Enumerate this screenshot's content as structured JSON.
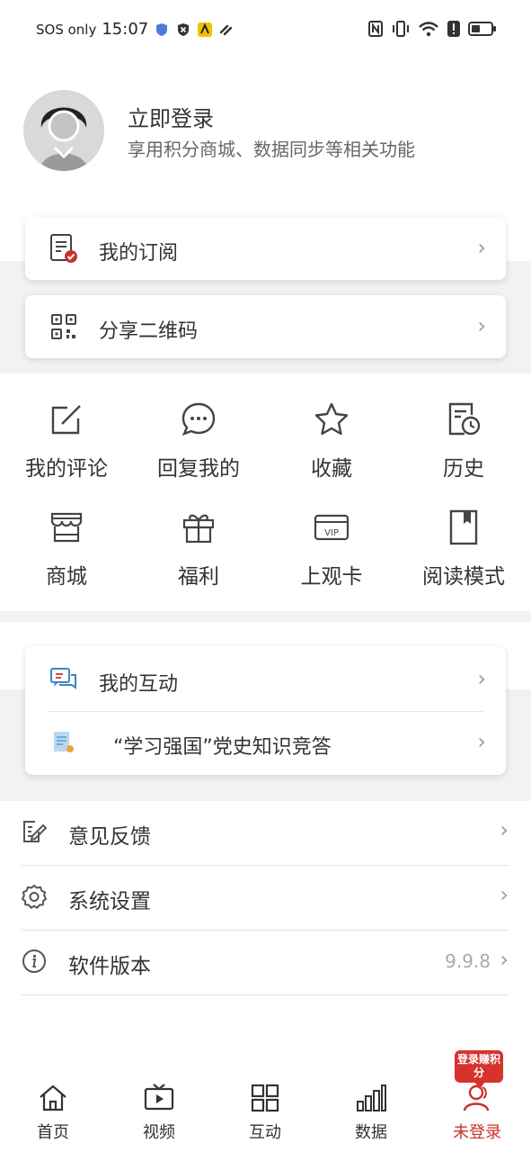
{
  "status_bar": {
    "carrier": "SOS only",
    "time": "15:07"
  },
  "profile": {
    "title": "立即登录",
    "subtitle": "享用积分商城、数据同步等相关功能"
  },
  "top_cards": [
    {
      "label": "我的订阅",
      "icon": "subscription-icon"
    },
    {
      "label": "分享二维码",
      "icon": "qr-code-icon"
    }
  ],
  "grid": [
    {
      "label": "我的评论",
      "icon": "edit-comment-icon"
    },
    {
      "label": "回复我的",
      "icon": "chat-bubble-icon"
    },
    {
      "label": "收藏",
      "icon": "star-icon"
    },
    {
      "label": "历史",
      "icon": "history-icon"
    },
    {
      "label": "商城",
      "icon": "store-icon"
    },
    {
      "label": "福利",
      "icon": "gift-icon"
    },
    {
      "label": "上观卡",
      "icon": "vip-card-icon"
    },
    {
      "label": "阅读模式",
      "icon": "bookmark-icon"
    }
  ],
  "interact_card": [
    {
      "label": "我的互动",
      "icon": "interaction-icon"
    },
    {
      "label": "“学习强国”党史知识竞答",
      "icon": "quiz-icon"
    }
  ],
  "settings": [
    {
      "label": "意见反馈",
      "icon": "feedback-icon",
      "value": ""
    },
    {
      "label": "系统设置",
      "icon": "gear-icon",
      "value": ""
    },
    {
      "label": "软件版本",
      "icon": "info-icon",
      "value": "9.9.8"
    }
  ],
  "tabbar": {
    "tabs": [
      {
        "label": "首页",
        "icon": "home-icon"
      },
      {
        "label": "视频",
        "icon": "video-icon"
      },
      {
        "label": "互动",
        "icon": "grid-icon"
      },
      {
        "label": "数据",
        "icon": "bar-chart-icon"
      },
      {
        "label": "未登录",
        "icon": "user-icon"
      }
    ],
    "active_index": 4,
    "badge": "登录赚积分"
  },
  "colors": {
    "accent": "#c8302b",
    "band": "#f2f2f2"
  }
}
